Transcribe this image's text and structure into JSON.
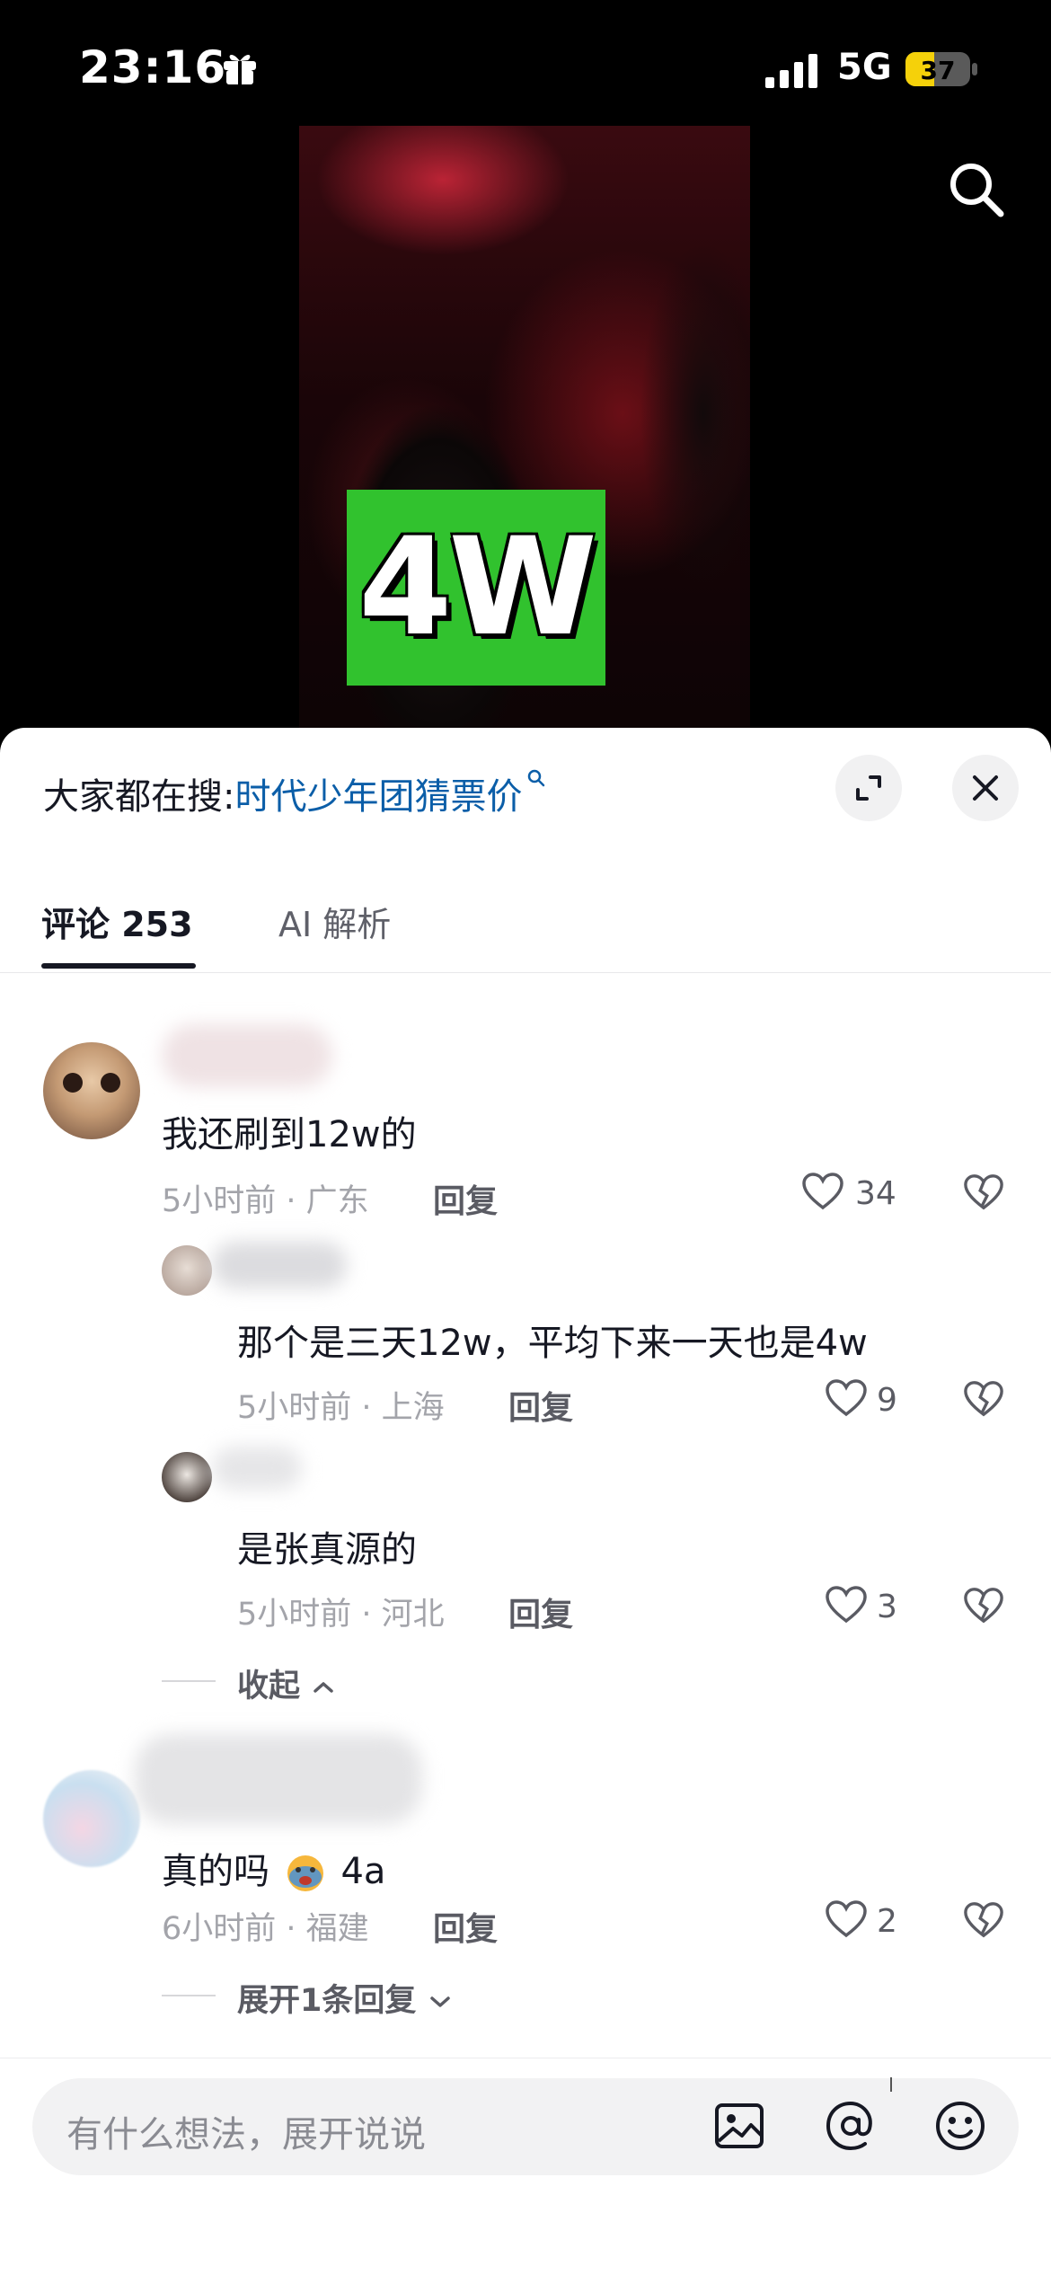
{
  "status_bar": {
    "time": "23:16",
    "network": "5G",
    "battery": "37"
  },
  "video": {
    "overlay_text": "4W"
  },
  "sheet": {
    "trending_prefix": "大家都在搜:",
    "trending_query": "时代少年团猜票价",
    "tabs": [
      {
        "label": "评论 253"
      },
      {
        "label": "AI 解析"
      }
    ]
  },
  "comments": [
    {
      "text": "我还刷到12w的",
      "meta": "5小时前 · 广东",
      "reply": "回复",
      "likes": "34",
      "replies": [
        {
          "text": "那个是三天12w，平均下来一天也是4w",
          "meta": "5小时前 · 上海",
          "reply": "回复",
          "likes": "9"
        },
        {
          "text": "是张真源的",
          "meta": "5小时前 · 河北",
          "reply": "回复",
          "likes": "3"
        }
      ],
      "fold_label": "收起"
    },
    {
      "text": "真的吗",
      "text_suffix": "4a",
      "meta": "6小时前 · 福建",
      "reply": "回复",
      "likes": "2",
      "fold_label": "展开1条回复"
    }
  ],
  "composer": {
    "placeholder": "有什么想法，展开说说"
  },
  "colors": {
    "link": "#0b5ea8",
    "badge_green": "#31c22e",
    "battery_yellow": "#f5d10a"
  }
}
